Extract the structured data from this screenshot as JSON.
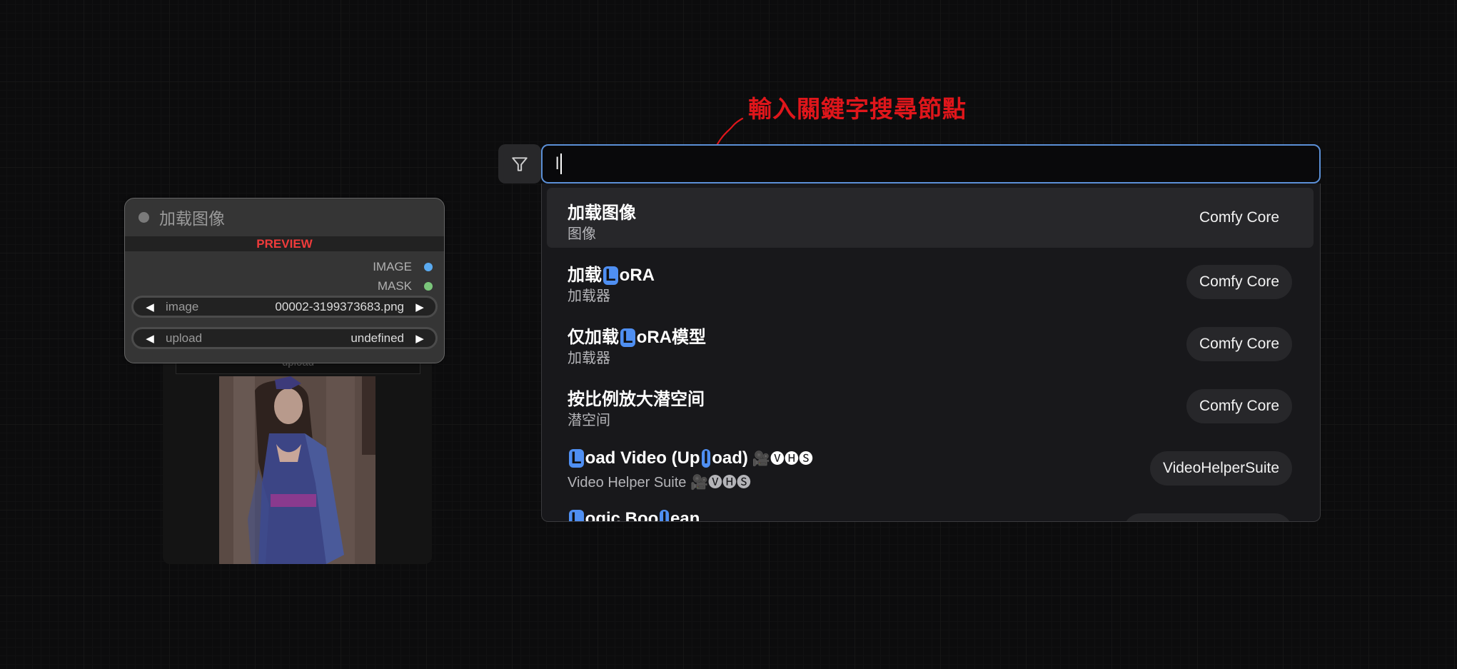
{
  "annotation": {
    "text": "輸入關鍵字搜尋節點",
    "color": "#e0161b"
  },
  "search": {
    "filter_icon": "filter-funnel-icon",
    "value": "l",
    "accent_color": "#5b8fd6"
  },
  "results": [
    {
      "title_parts": [
        {
          "t": "加载图像",
          "hl": false
        }
      ],
      "subtitle": "图像",
      "badge": "Comfy Core",
      "active": true
    },
    {
      "title_parts": [
        {
          "t": "加载",
          "hl": false
        },
        {
          "t": "L",
          "hl": true
        },
        {
          "t": "oRA",
          "hl": false
        }
      ],
      "subtitle": "加载器",
      "badge": "Comfy Core",
      "active": false
    },
    {
      "title_parts": [
        {
          "t": "仅加载",
          "hl": false
        },
        {
          "t": "L",
          "hl": true
        },
        {
          "t": "oRA模型",
          "hl": false
        }
      ],
      "subtitle": "加载器",
      "badge": "Comfy Core",
      "active": false
    },
    {
      "title_parts": [
        {
          "t": "按比例放大潜空间",
          "hl": false
        }
      ],
      "subtitle": "潜空间",
      "badge": "Comfy Core",
      "active": false
    },
    {
      "title_parts": [
        {
          "t": "L",
          "hl": true
        },
        {
          "t": "oad Video (Up",
          "hl": false
        },
        {
          "t": "l",
          "hl": true
        },
        {
          "t": "oad)",
          "hl": false
        }
      ],
      "title_suffix": "🎥🅥🅗🅢",
      "subtitle": "Video Helper Suite 🎥🅥🅗🅢",
      "badge": "VideoHelperSuite",
      "active": false
    },
    {
      "title_parts": [
        {
          "t": "L",
          "hl": true
        },
        {
          "t": "ogic Boo",
          "hl": false
        },
        {
          "t": "l",
          "hl": true
        },
        {
          "t": "ean",
          "hl": false
        }
      ],
      "subtitle": "",
      "badge": "",
      "active": false
    }
  ],
  "node": {
    "title": "加载图像",
    "preview_label": "PREVIEW",
    "preview_label_color": "#ef3b3b",
    "outputs": [
      {
        "label": "IMAGE",
        "color": "#5aaaf0"
      },
      {
        "label": "MASK",
        "color": "#7ac57a"
      }
    ],
    "widgets": [
      {
        "label": "image",
        "value": "00002-3199373683.png"
      },
      {
        "label": "upload",
        "value": "undefined"
      }
    ]
  },
  "background_node": {
    "upload_label": "upload",
    "preview_image": "portrait-image"
  }
}
